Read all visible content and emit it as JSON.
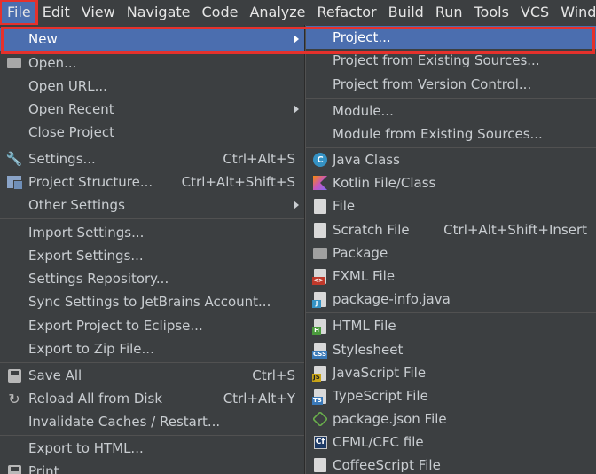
{
  "menubar": {
    "items": [
      "File",
      "Edit",
      "View",
      "Navigate",
      "Code",
      "Analyze",
      "Refactor",
      "Build",
      "Run",
      "Tools",
      "VCS",
      "Windo"
    ]
  },
  "file_menu": {
    "new": "New",
    "open": "Open...",
    "open_url": "Open URL...",
    "open_recent": "Open Recent",
    "close_project": "Close Project",
    "settings": "Settings...",
    "settings_sc": "Ctrl+Alt+S",
    "project_structure": "Project Structure...",
    "project_structure_sc": "Ctrl+Alt+Shift+S",
    "other_settings": "Other Settings",
    "import_settings": "Import Settings...",
    "export_settings": "Export Settings...",
    "settings_repository": "Settings Repository...",
    "sync_settings": "Sync Settings to JetBrains Account...",
    "export_eclipse": "Export Project to Eclipse...",
    "export_zip": "Export to Zip File...",
    "save_all": "Save All",
    "save_all_sc": "Ctrl+S",
    "reload": "Reload All from Disk",
    "reload_sc": "Ctrl+Alt+Y",
    "invalidate": "Invalidate Caches / Restart...",
    "export_html": "Export to HTML...",
    "print": "Print..."
  },
  "new_submenu": {
    "project": "Project...",
    "project_existing": "Project from Existing Sources...",
    "project_vcs": "Project from Version Control...",
    "module": "Module...",
    "module_existing": "Module from Existing Sources...",
    "java_class": "Java Class",
    "kotlin": "Kotlin File/Class",
    "file": "File",
    "scratch": "Scratch File",
    "scratch_sc": "Ctrl+Alt+Shift+Insert",
    "package": "Package",
    "fxml": "FXML File",
    "package_info": "package-info.java",
    "html": "HTML File",
    "stylesheet": "Stylesheet",
    "javascript": "JavaScript File",
    "typescript": "TypeScript File",
    "package_json": "package.json File",
    "cfml": "CFML/CFC file",
    "coffeescript": "CoffeeScript File"
  },
  "icon_tags": {
    "java_class": "C",
    "fxml": "<>",
    "package_info": "J",
    "html": "H",
    "css": "CSS",
    "js": "JS",
    "ts": "TS",
    "cf": "Cf"
  },
  "colors": {
    "selection": "#4b6eaf",
    "highlight_outline": "#e5312c",
    "menu_bg": "#3c3f41"
  }
}
